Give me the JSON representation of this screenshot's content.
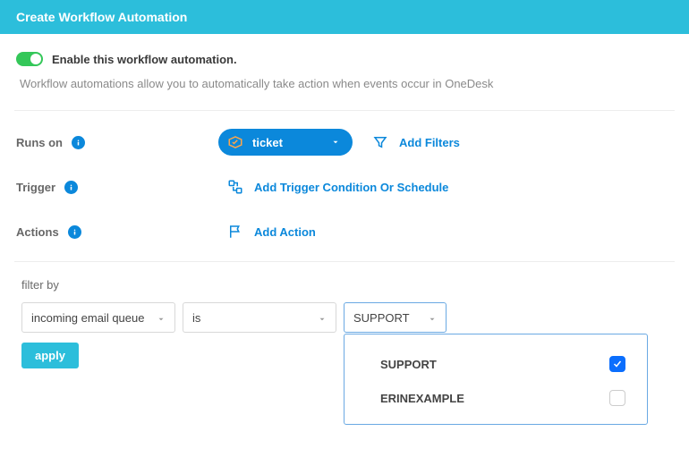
{
  "header": {
    "title": "Create Workflow Automation"
  },
  "enable": {
    "label": "Enable this workflow automation.",
    "enabled": true,
    "description": "Workflow automations allow you to automatically take action when events occur in OneDesk"
  },
  "config": {
    "runsOn": {
      "label": "Runs on",
      "pillValue": "ticket",
      "addFilters": "Add Filters"
    },
    "trigger": {
      "label": "Trigger",
      "addCondition": "Add Trigger Condition Or Schedule"
    },
    "actions": {
      "label": "Actions",
      "addAction": "Add Action"
    }
  },
  "filter": {
    "label": "filter by",
    "field": "incoming email queue",
    "operator": "is",
    "valueSelected": "SUPPORT",
    "applyLabel": "apply",
    "options": [
      {
        "label": "SUPPORT",
        "checked": true
      },
      {
        "label": "ERINEXAMPLE",
        "checked": false
      }
    ]
  }
}
